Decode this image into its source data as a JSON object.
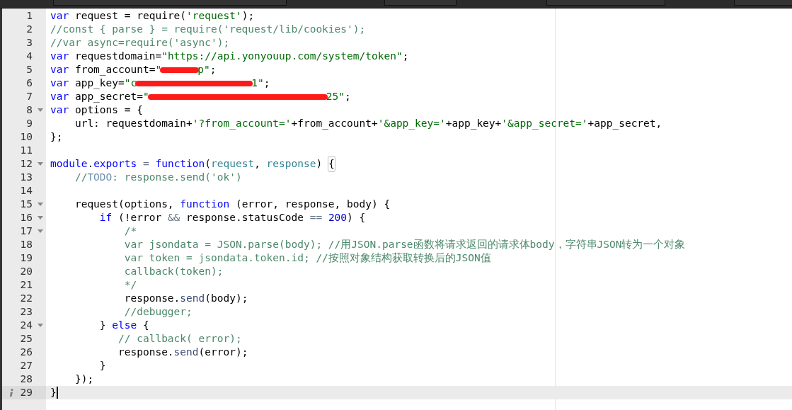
{
  "editor": {
    "lines": [
      {
        "number": "1",
        "fold": false,
        "active": false,
        "tokens": [
          {
            "kind": "keyword",
            "text": "var"
          },
          {
            "kind": "plain",
            "text": " request = require("
          },
          {
            "kind": "string",
            "text": "'request'"
          },
          {
            "kind": "plain",
            "text": ");"
          }
        ]
      },
      {
        "number": "2",
        "fold": false,
        "active": false,
        "tokens": [
          {
            "kind": "comment",
            "text": "//const { parse } = require('request/lib/cookies');"
          }
        ]
      },
      {
        "number": "3",
        "fold": false,
        "active": false,
        "tokens": [
          {
            "kind": "comment",
            "text": "//var async=require('async');"
          }
        ]
      },
      {
        "number": "4",
        "fold": false,
        "active": false,
        "tokens": [
          {
            "kind": "keyword",
            "text": "var"
          },
          {
            "kind": "plain",
            "text": " requestdomain="
          },
          {
            "kind": "string",
            "text": "\"https://api.yonyouup.com/system/token\""
          },
          {
            "kind": "plain",
            "text": ";"
          }
        ]
      },
      {
        "number": "5",
        "fold": false,
        "active": false,
        "tokens": [
          {
            "kind": "keyword",
            "text": "var"
          },
          {
            "kind": "plain",
            "text": " from_account="
          },
          {
            "kind": "string",
            "text": "\""
          },
          {
            "kind": "smudge"
          },
          {
            "kind": "string",
            "text": "p\""
          },
          {
            "kind": "plain",
            "text": ";"
          }
        ]
      },
      {
        "number": "6",
        "fold": false,
        "active": false,
        "tokens": [
          {
            "kind": "keyword",
            "text": "var"
          },
          {
            "kind": "plain",
            "text": " app_key="
          },
          {
            "kind": "string",
            "text": "\"c"
          },
          {
            "kind": "scribble"
          },
          {
            "kind": "string",
            "text": "1\""
          },
          {
            "kind": "plain",
            "text": ";"
          }
        ]
      },
      {
        "number": "7",
        "fold": false,
        "active": false,
        "tokens": [
          {
            "kind": "keyword",
            "text": "var"
          },
          {
            "kind": "plain",
            "text": " app_secret="
          },
          {
            "kind": "string",
            "text": "\""
          },
          {
            "kind": "strikeout"
          },
          {
            "kind": "string",
            "text": "25\""
          },
          {
            "kind": "plain",
            "text": ";"
          }
        ]
      },
      {
        "number": "8",
        "fold": true,
        "active": false,
        "tokens": [
          {
            "kind": "keyword",
            "text": "var"
          },
          {
            "kind": "plain",
            "text": " options = {"
          }
        ]
      },
      {
        "number": "9",
        "fold": false,
        "active": false,
        "tokens": [
          {
            "kind": "plain",
            "text": "    url: requestdomain+"
          },
          {
            "kind": "string",
            "text": "'?from_account='"
          },
          {
            "kind": "plain",
            "text": "+from_account+"
          },
          {
            "kind": "string",
            "text": "'&app_key='"
          },
          {
            "kind": "plain",
            "text": "+app_key+"
          },
          {
            "kind": "string",
            "text": "'&app_secret='"
          },
          {
            "kind": "plain",
            "text": "+app_secret,"
          }
        ]
      },
      {
        "number": "10",
        "fold": false,
        "active": false,
        "tokens": [
          {
            "kind": "plain",
            "text": "};"
          }
        ]
      },
      {
        "number": "11",
        "fold": false,
        "active": false
      },
      {
        "number": "12",
        "fold": true,
        "active": false,
        "tokens": [
          {
            "kind": "keyword",
            "text": "module"
          },
          {
            "kind": "plain",
            "text": "."
          },
          {
            "kind": "keyword",
            "text": "exports"
          },
          {
            "kind": "operator",
            "text": " = "
          },
          {
            "kind": "keyword",
            "text": "function"
          },
          {
            "kind": "plain",
            "text": "("
          },
          {
            "kind": "param",
            "text": "request"
          },
          {
            "kind": "plain",
            "text": ", "
          },
          {
            "kind": "param",
            "text": "response"
          },
          {
            "kind": "plain",
            "text": ") "
          },
          {
            "kind": "bracket",
            "text": "{"
          }
        ]
      },
      {
        "number": "13",
        "fold": false,
        "active": false,
        "tokens": [
          {
            "kind": "comment",
            "text": "    //"
          },
          {
            "kind": "todo",
            "text": "TODO"
          },
          {
            "kind": "comment",
            "text": ": response.send('ok')"
          }
        ]
      },
      {
        "number": "14",
        "fold": false,
        "active": false
      },
      {
        "number": "15",
        "fold": true,
        "active": false,
        "tokens": [
          {
            "kind": "plain",
            "text": "    request(options, "
          },
          {
            "kind": "keyword",
            "text": "function"
          },
          {
            "kind": "plain",
            "text": " (error, response, body) {"
          }
        ]
      },
      {
        "number": "16",
        "fold": true,
        "active": false,
        "tokens": [
          {
            "kind": "keyword",
            "text": "        if"
          },
          {
            "kind": "plain",
            "text": " (!error "
          },
          {
            "kind": "operator",
            "text": "&&"
          },
          {
            "kind": "plain",
            "text": " response.statusCode "
          },
          {
            "kind": "operator",
            "text": "=="
          },
          {
            "kind": "number",
            "text": " 200"
          },
          {
            "kind": "plain",
            "text": ") {"
          }
        ]
      },
      {
        "number": "17",
        "fold": true,
        "active": false,
        "tokens": [
          {
            "kind": "comment",
            "text": "            /*"
          }
        ]
      },
      {
        "number": "18",
        "fold": false,
        "active": false,
        "tokens": [
          {
            "kind": "comment",
            "text": "            var jsondata = JSON.parse(body); //用JSON.parse函数将请求返回的请求体body，字符串JSON转为一个对象"
          }
        ]
      },
      {
        "number": "19",
        "fold": false,
        "active": false,
        "tokens": [
          {
            "kind": "comment",
            "text": "            var token = jsondata.token.id; //按照对象结构获取转换后的JSON值"
          }
        ]
      },
      {
        "number": "20",
        "fold": false,
        "active": false,
        "tokens": [
          {
            "kind": "comment",
            "text": "            callback(token);"
          }
        ]
      },
      {
        "number": "21",
        "fold": false,
        "active": false,
        "tokens": [
          {
            "kind": "comment",
            "text": "            */"
          }
        ]
      },
      {
        "number": "22",
        "fold": false,
        "active": false,
        "tokens": [
          {
            "kind": "plain",
            "text": "            response."
          },
          {
            "kind": "function",
            "text": "send"
          },
          {
            "kind": "plain",
            "text": "(body);"
          }
        ]
      },
      {
        "number": "23",
        "fold": false,
        "active": false,
        "tokens": [
          {
            "kind": "comment",
            "text": "            //debugger;"
          }
        ]
      },
      {
        "number": "24",
        "fold": true,
        "active": false,
        "tokens": [
          {
            "kind": "plain",
            "text": "        } "
          },
          {
            "kind": "keyword",
            "text": "else"
          },
          {
            "kind": "plain",
            "text": " {"
          }
        ]
      },
      {
        "number": "25",
        "fold": false,
        "active": false,
        "tokens": [
          {
            "kind": "comment",
            "text": "           // callback( error);"
          }
        ]
      },
      {
        "number": "26",
        "fold": false,
        "active": false,
        "tokens": [
          {
            "kind": "plain",
            "text": "           response."
          },
          {
            "kind": "function",
            "text": "send"
          },
          {
            "kind": "plain",
            "text": "(error);"
          }
        ]
      },
      {
        "number": "27",
        "fold": false,
        "active": false,
        "tokens": [
          {
            "kind": "plain",
            "text": "        }"
          }
        ]
      },
      {
        "number": "28",
        "fold": false,
        "active": false,
        "tokens": [
          {
            "kind": "plain",
            "text": "    });"
          }
        ]
      },
      {
        "number": "29",
        "fold": false,
        "active": true,
        "info": true,
        "tokens": [
          {
            "kind": "plain",
            "text": "}"
          }
        ]
      }
    ]
  }
}
